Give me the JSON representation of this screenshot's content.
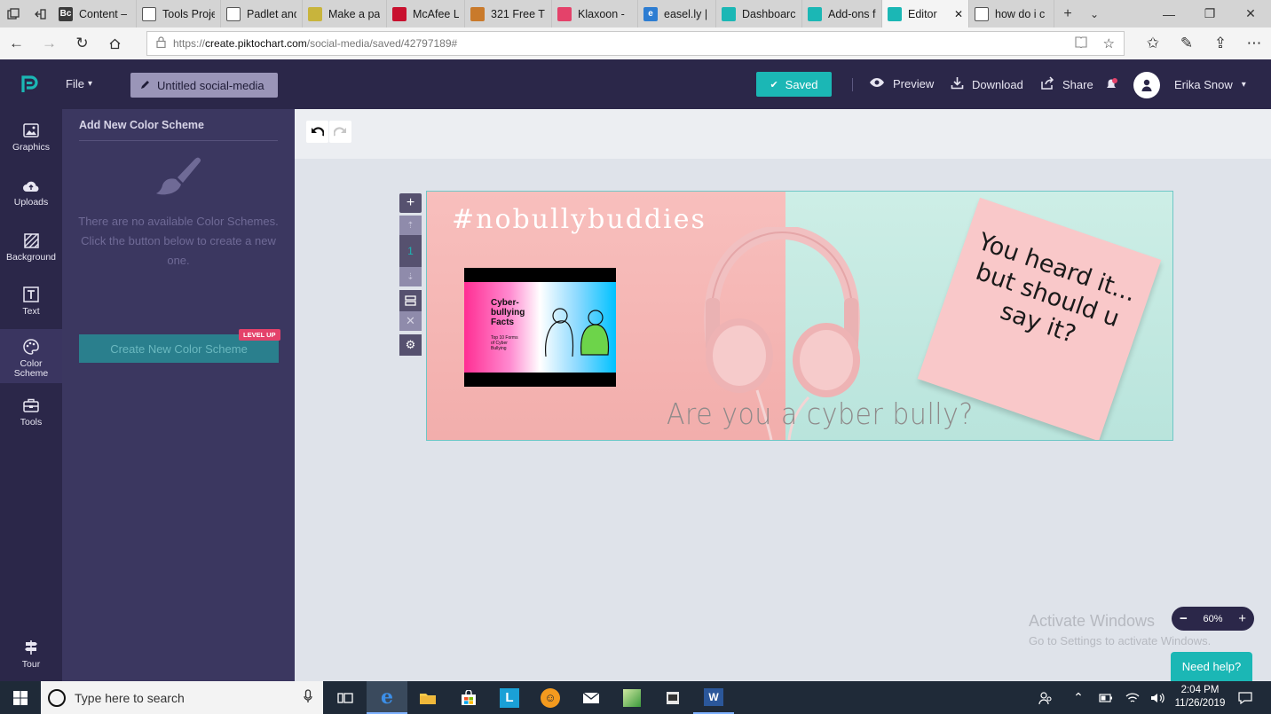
{
  "browser": {
    "tabs": [
      {
        "label": "Content –",
        "favicon_color": "#3b3b3b",
        "favicon_text": "Bc"
      },
      {
        "label": "Tools Proje",
        "favicon_color": "#ffffff",
        "favicon_text": ""
      },
      {
        "label": "Padlet and",
        "favicon_color": "#ffffff",
        "favicon_text": ""
      },
      {
        "label": "Make a pa",
        "favicon_color": "#c8b43c",
        "favicon_text": ""
      },
      {
        "label": "McAfee Li",
        "favicon_color": "#c8102e",
        "favicon_text": ""
      },
      {
        "label": "321 Free T",
        "favicon_color": "#c97a2b",
        "favicon_text": ""
      },
      {
        "label": "Klaxoon -",
        "favicon_color": "#e4426a",
        "favicon_text": ""
      },
      {
        "label": "easel.ly | c",
        "favicon_color": "#2d7dd2",
        "favicon_text": "e"
      },
      {
        "label": "Dashboarc",
        "favicon_color": "#1bb7b5",
        "favicon_text": ""
      },
      {
        "label": "Add-ons fc",
        "favicon_color": "#1bb7b5",
        "favicon_text": ""
      },
      {
        "label": "Editor",
        "favicon_color": "#1bb7b5",
        "favicon_text": ""
      },
      {
        "label": "how do i c",
        "favicon_color": "#ffffff",
        "favicon_text": ""
      }
    ],
    "active_tab_index": 10,
    "url_prefix": "https://",
    "url_host": "create.piktochart.com",
    "url_path": "/social-media/saved/42797189#"
  },
  "header": {
    "file_menu": "File",
    "doc_title": "Untitled social-media",
    "saved_label": "Saved",
    "preview_label": "Preview",
    "download_label": "Download",
    "share_label": "Share",
    "user_name": "Erika Snow"
  },
  "sidebar": {
    "items": [
      {
        "label": "Graphics",
        "icon": "image-icon"
      },
      {
        "label": "Uploads",
        "icon": "cloud-upload-icon"
      },
      {
        "label": "Background",
        "icon": "background-icon"
      },
      {
        "label": "Text",
        "icon": "text-icon"
      },
      {
        "label": "Color Scheme",
        "icon": "palette-icon"
      },
      {
        "label": "Tools",
        "icon": "toolbox-icon"
      }
    ],
    "tour_label": "Tour"
  },
  "panel": {
    "title": "Add New Color Scheme",
    "empty_message": "There are no available Color Schemes. Click the button below to create a new one.",
    "create_button": "Create New Color Scheme",
    "badge": "LEVEL UP"
  },
  "canvas": {
    "hashtag": "#nobullybuddies",
    "thumbnail_title": "Cyber-bullying Facts",
    "thumbnail_subtitle": "Top 10 Forms of Cyber Bullying",
    "note_line1": "You heard it...",
    "note_line2": "but should u",
    "note_line3": "say it?",
    "bottom_text": "Are you a cyber bully?",
    "page_number": "1"
  },
  "zoom": {
    "level": "60%"
  },
  "watermark": {
    "title": "Activate Windows",
    "subtitle": "Go to Settings to activate Windows."
  },
  "help_button": "Need help?",
  "taskbar": {
    "search_placeholder": "Type here to search",
    "time": "2:04 PM",
    "date": "11/26/2019"
  },
  "colors": {
    "header_bg": "#2b2749",
    "panel_bg": "#3b3760",
    "accent_teal": "#1bb7b5",
    "pink": "#f4b4b3",
    "mint": "#c8ebe3"
  }
}
